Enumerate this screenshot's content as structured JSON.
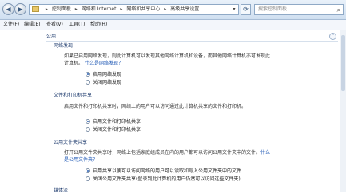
{
  "address": {
    "path": [
      "控制面板",
      "网络和 Internet",
      "网络和共享中心",
      "高级共享设置"
    ],
    "search_placeholder": "搜索控制面板"
  },
  "menu": [
    "文件(F)",
    "编辑(E)",
    "查看(V)",
    "工具(T)",
    "帮助(H)"
  ],
  "sections": {
    "profile_header": "公用",
    "discovery": {
      "title": "网络发现",
      "desc1": "如果已启用网络发现，则此计算机可以发现其他网络计算机和设备，而其他网络计算机亦可发现此",
      "desc2": "计算机。",
      "link": "什么是网络发现？",
      "opt_on": "启用网络发现",
      "opt_off": "关闭网络发现"
    },
    "file_sharing": {
      "title": "文件和打印机共享",
      "desc": "启用文件和打印机共享时，网络上的用户可以访问通过此计算机共享的文件和打印机。",
      "opt_on": "启用文件和打印机共享",
      "opt_off": "关闭文件和打印机共享"
    },
    "public_folder": {
      "title": "公用文件夹共享",
      "desc1": "打开公用文件夹共享时，网络上包括家庭组成员在内的用户都可以访问公用文件夹中的文件。",
      "link1": "什么",
      "desc2": "是公用文件夹？",
      "opt_on": "启用共享以便可以访问网络的用户可以读取和写入公用文件夹中的文件",
      "opt_off": "关闭公用文件夹共享(登录到此计算机的用户仍然可以访问这些文件夹)"
    },
    "next_title": "媒体流"
  }
}
